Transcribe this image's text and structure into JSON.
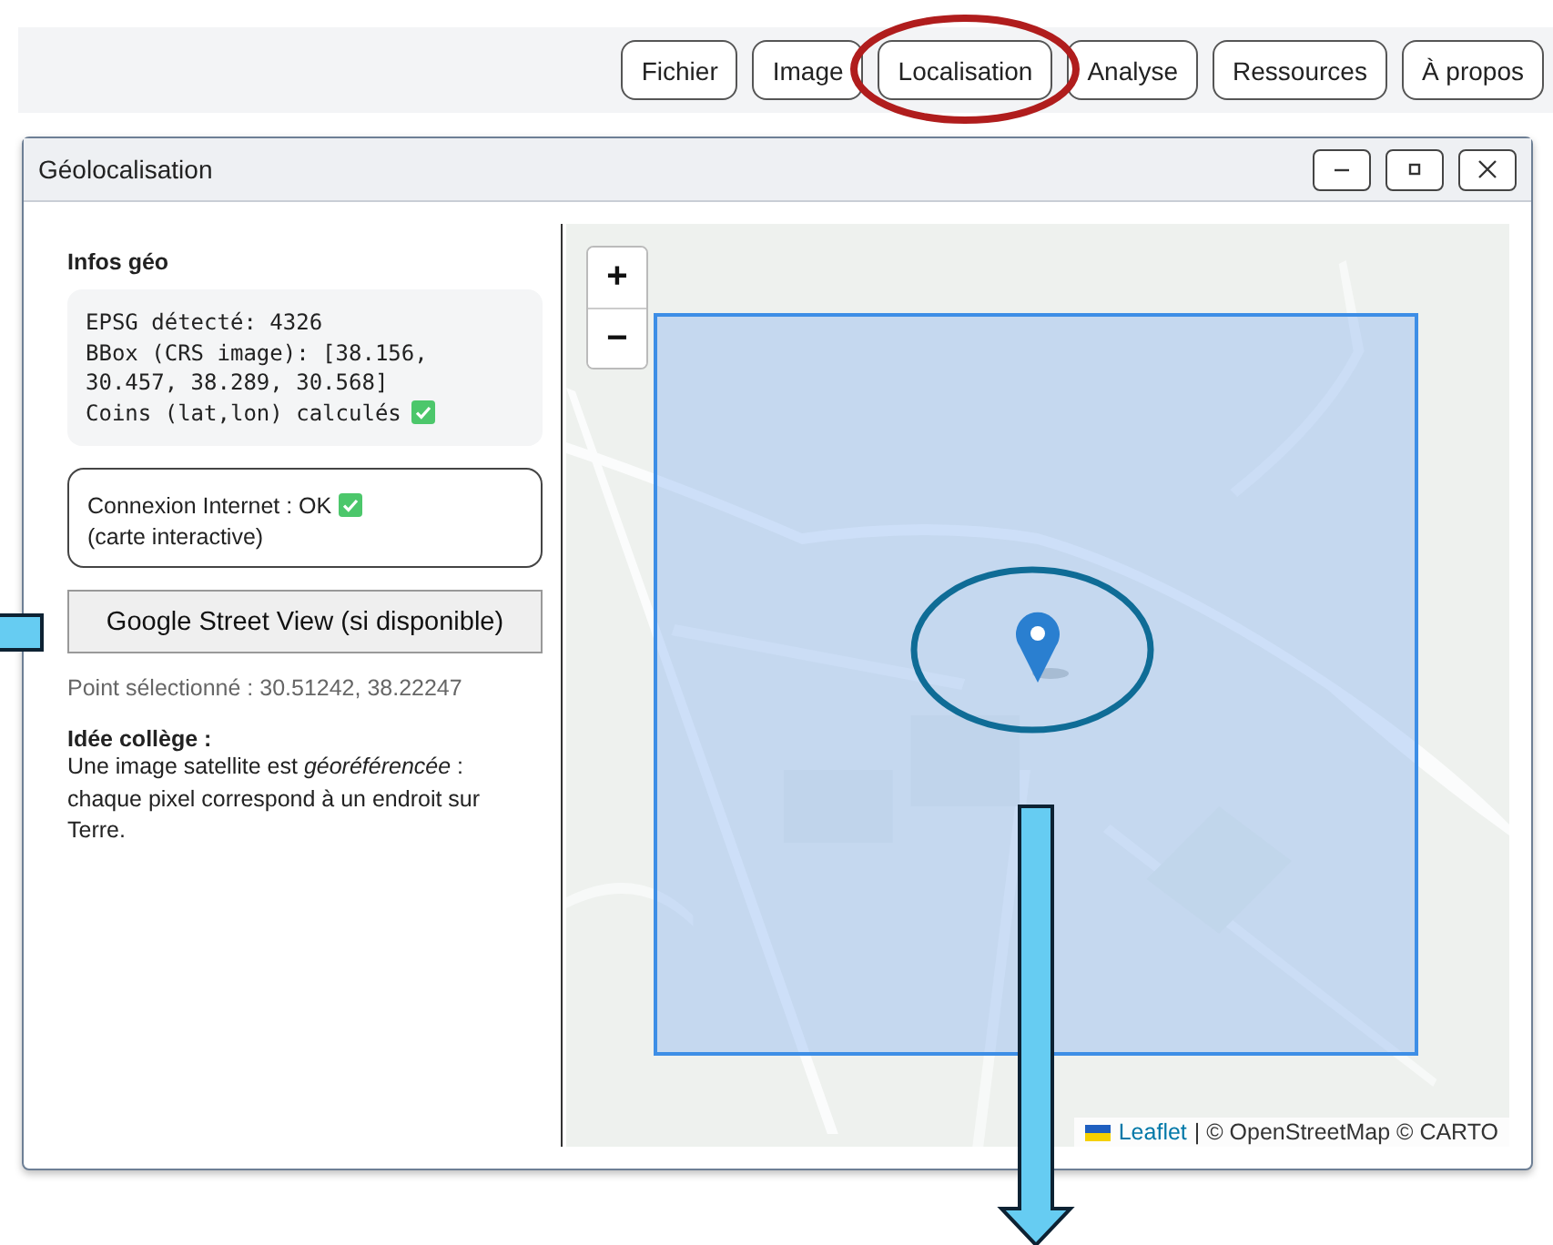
{
  "menu": [
    "Fichier",
    "Image",
    "Localisation",
    "Analyse",
    "Ressources",
    "À propos"
  ],
  "window": {
    "title": "Géolocalisation"
  },
  "geo_info": {
    "title": "Infos géo",
    "lines": [
      {
        "text": "EPSG détecté: 4326",
        "check": false
      },
      {
        "text": "BBox (CRS image): [38.156, 30.457, 38.289, 30.568]",
        "check": false
      },
      {
        "text": "Coins (lat,lon) calculés",
        "check": true
      }
    ]
  },
  "connection": {
    "before": "Connexion Internet : OK",
    "check": true,
    "after": "(carte interactive)"
  },
  "street_view_button": "Google Street View (si disponible)",
  "selected_point": "Point sélectionné : 30.51242, 38.22247",
  "tip": {
    "title": "Idée collège :",
    "text": "Une image satellite est *géoréférencée* : chaque pixel correspond à un endroit sur Terre."
  },
  "map": {
    "kind": "picture",
    "zoom_in": "+",
    "zoom_out": "−",
    "attribution_link": "Leaflet",
    "attribution": "| © OpenStreetMap © CARTO"
  }
}
